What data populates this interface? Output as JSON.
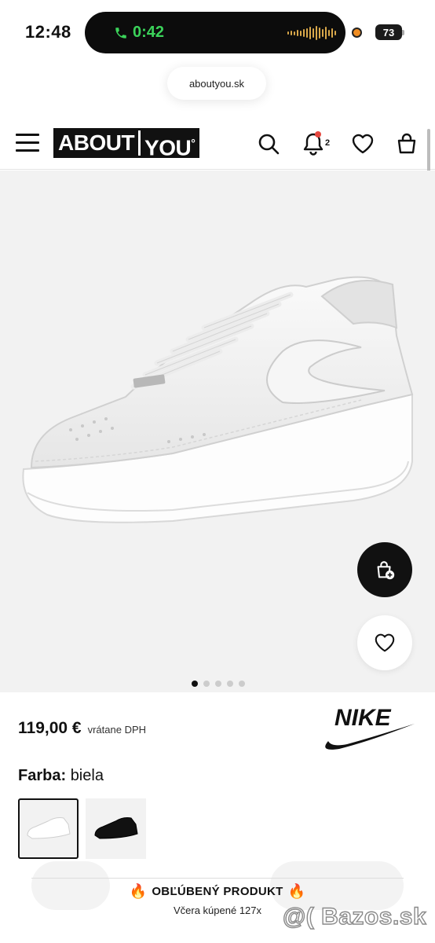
{
  "status_bar": {
    "time": "12:48",
    "call_timer": "0:42",
    "battery": "73"
  },
  "browser": {
    "url": "aboutyou.sk"
  },
  "header": {
    "logo_left": "ABOUT",
    "logo_right": "YOU",
    "notification_count": "2"
  },
  "gallery": {
    "image_count": 5,
    "active_index": 0
  },
  "product": {
    "price": "119,00 €",
    "vat_note": "vrátane DPH",
    "brand": "NIKE",
    "color_label": "Farba:",
    "color_value": "biela",
    "swatches": [
      {
        "color": "white",
        "selected": true
      },
      {
        "color": "black",
        "selected": false
      }
    ]
  },
  "popular": {
    "title": "OBĽÚBENÝ PRODUKT",
    "subtitle": "Včera kúpené 127x",
    "icon": "flame-icon"
  },
  "watermark": "@( Bazos.sk"
}
